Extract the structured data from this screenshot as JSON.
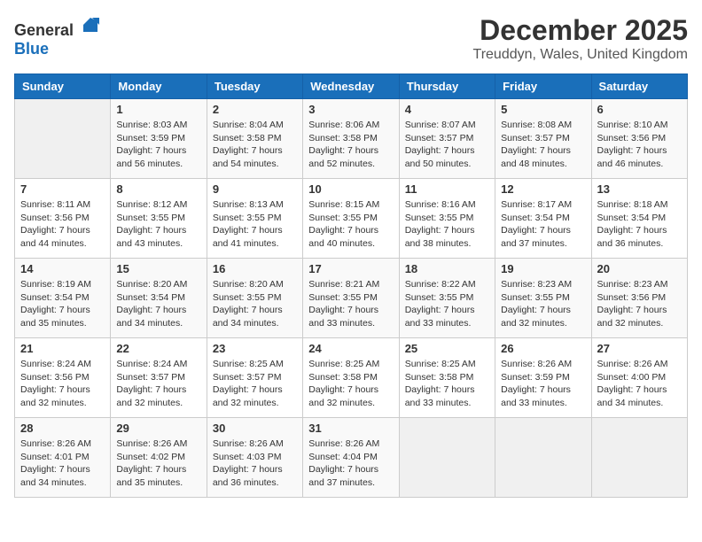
{
  "logo": {
    "general": "General",
    "blue": "Blue"
  },
  "title": {
    "month": "December 2025",
    "location": "Treuddyn, Wales, United Kingdom"
  },
  "days_header": [
    "Sunday",
    "Monday",
    "Tuesday",
    "Wednesday",
    "Thursday",
    "Friday",
    "Saturday"
  ],
  "weeks": [
    [
      {
        "day": "",
        "empty": true
      },
      {
        "day": "1",
        "sunrise": "Sunrise: 8:03 AM",
        "sunset": "Sunset: 3:59 PM",
        "daylight": "Daylight: 7 hours and 56 minutes."
      },
      {
        "day": "2",
        "sunrise": "Sunrise: 8:04 AM",
        "sunset": "Sunset: 3:58 PM",
        "daylight": "Daylight: 7 hours and 54 minutes."
      },
      {
        "day": "3",
        "sunrise": "Sunrise: 8:06 AM",
        "sunset": "Sunset: 3:58 PM",
        "daylight": "Daylight: 7 hours and 52 minutes."
      },
      {
        "day": "4",
        "sunrise": "Sunrise: 8:07 AM",
        "sunset": "Sunset: 3:57 PM",
        "daylight": "Daylight: 7 hours and 50 minutes."
      },
      {
        "day": "5",
        "sunrise": "Sunrise: 8:08 AM",
        "sunset": "Sunset: 3:57 PM",
        "daylight": "Daylight: 7 hours and 48 minutes."
      },
      {
        "day": "6",
        "sunrise": "Sunrise: 8:10 AM",
        "sunset": "Sunset: 3:56 PM",
        "daylight": "Daylight: 7 hours and 46 minutes."
      }
    ],
    [
      {
        "day": "7",
        "sunrise": "Sunrise: 8:11 AM",
        "sunset": "Sunset: 3:56 PM",
        "daylight": "Daylight: 7 hours and 44 minutes."
      },
      {
        "day": "8",
        "sunrise": "Sunrise: 8:12 AM",
        "sunset": "Sunset: 3:55 PM",
        "daylight": "Daylight: 7 hours and 43 minutes."
      },
      {
        "day": "9",
        "sunrise": "Sunrise: 8:13 AM",
        "sunset": "Sunset: 3:55 PM",
        "daylight": "Daylight: 7 hours and 41 minutes."
      },
      {
        "day": "10",
        "sunrise": "Sunrise: 8:15 AM",
        "sunset": "Sunset: 3:55 PM",
        "daylight": "Daylight: 7 hours and 40 minutes."
      },
      {
        "day": "11",
        "sunrise": "Sunrise: 8:16 AM",
        "sunset": "Sunset: 3:55 PM",
        "daylight": "Daylight: 7 hours and 38 minutes."
      },
      {
        "day": "12",
        "sunrise": "Sunrise: 8:17 AM",
        "sunset": "Sunset: 3:54 PM",
        "daylight": "Daylight: 7 hours and 37 minutes."
      },
      {
        "day": "13",
        "sunrise": "Sunrise: 8:18 AM",
        "sunset": "Sunset: 3:54 PM",
        "daylight": "Daylight: 7 hours and 36 minutes."
      }
    ],
    [
      {
        "day": "14",
        "sunrise": "Sunrise: 8:19 AM",
        "sunset": "Sunset: 3:54 PM",
        "daylight": "Daylight: 7 hours and 35 minutes."
      },
      {
        "day": "15",
        "sunrise": "Sunrise: 8:20 AM",
        "sunset": "Sunset: 3:54 PM",
        "daylight": "Daylight: 7 hours and 34 minutes."
      },
      {
        "day": "16",
        "sunrise": "Sunrise: 8:20 AM",
        "sunset": "Sunset: 3:55 PM",
        "daylight": "Daylight: 7 hours and 34 minutes."
      },
      {
        "day": "17",
        "sunrise": "Sunrise: 8:21 AM",
        "sunset": "Sunset: 3:55 PM",
        "daylight": "Daylight: 7 hours and 33 minutes."
      },
      {
        "day": "18",
        "sunrise": "Sunrise: 8:22 AM",
        "sunset": "Sunset: 3:55 PM",
        "daylight": "Daylight: 7 hours and 33 minutes."
      },
      {
        "day": "19",
        "sunrise": "Sunrise: 8:23 AM",
        "sunset": "Sunset: 3:55 PM",
        "daylight": "Daylight: 7 hours and 32 minutes."
      },
      {
        "day": "20",
        "sunrise": "Sunrise: 8:23 AM",
        "sunset": "Sunset: 3:56 PM",
        "daylight": "Daylight: 7 hours and 32 minutes."
      }
    ],
    [
      {
        "day": "21",
        "sunrise": "Sunrise: 8:24 AM",
        "sunset": "Sunset: 3:56 PM",
        "daylight": "Daylight: 7 hours and 32 minutes."
      },
      {
        "day": "22",
        "sunrise": "Sunrise: 8:24 AM",
        "sunset": "Sunset: 3:57 PM",
        "daylight": "Daylight: 7 hours and 32 minutes."
      },
      {
        "day": "23",
        "sunrise": "Sunrise: 8:25 AM",
        "sunset": "Sunset: 3:57 PM",
        "daylight": "Daylight: 7 hours and 32 minutes."
      },
      {
        "day": "24",
        "sunrise": "Sunrise: 8:25 AM",
        "sunset": "Sunset: 3:58 PM",
        "daylight": "Daylight: 7 hours and 32 minutes."
      },
      {
        "day": "25",
        "sunrise": "Sunrise: 8:25 AM",
        "sunset": "Sunset: 3:58 PM",
        "daylight": "Daylight: 7 hours and 33 minutes."
      },
      {
        "day": "26",
        "sunrise": "Sunrise: 8:26 AM",
        "sunset": "Sunset: 3:59 PM",
        "daylight": "Daylight: 7 hours and 33 minutes."
      },
      {
        "day": "27",
        "sunrise": "Sunrise: 8:26 AM",
        "sunset": "Sunset: 4:00 PM",
        "daylight": "Daylight: 7 hours and 34 minutes."
      }
    ],
    [
      {
        "day": "28",
        "sunrise": "Sunrise: 8:26 AM",
        "sunset": "Sunset: 4:01 PM",
        "daylight": "Daylight: 7 hours and 34 minutes."
      },
      {
        "day": "29",
        "sunrise": "Sunrise: 8:26 AM",
        "sunset": "Sunset: 4:02 PM",
        "daylight": "Daylight: 7 hours and 35 minutes."
      },
      {
        "day": "30",
        "sunrise": "Sunrise: 8:26 AM",
        "sunset": "Sunset: 4:03 PM",
        "daylight": "Daylight: 7 hours and 36 minutes."
      },
      {
        "day": "31",
        "sunrise": "Sunrise: 8:26 AM",
        "sunset": "Sunset: 4:04 PM",
        "daylight": "Daylight: 7 hours and 37 minutes."
      },
      {
        "day": "",
        "empty": true
      },
      {
        "day": "",
        "empty": true
      },
      {
        "day": "",
        "empty": true
      }
    ]
  ]
}
